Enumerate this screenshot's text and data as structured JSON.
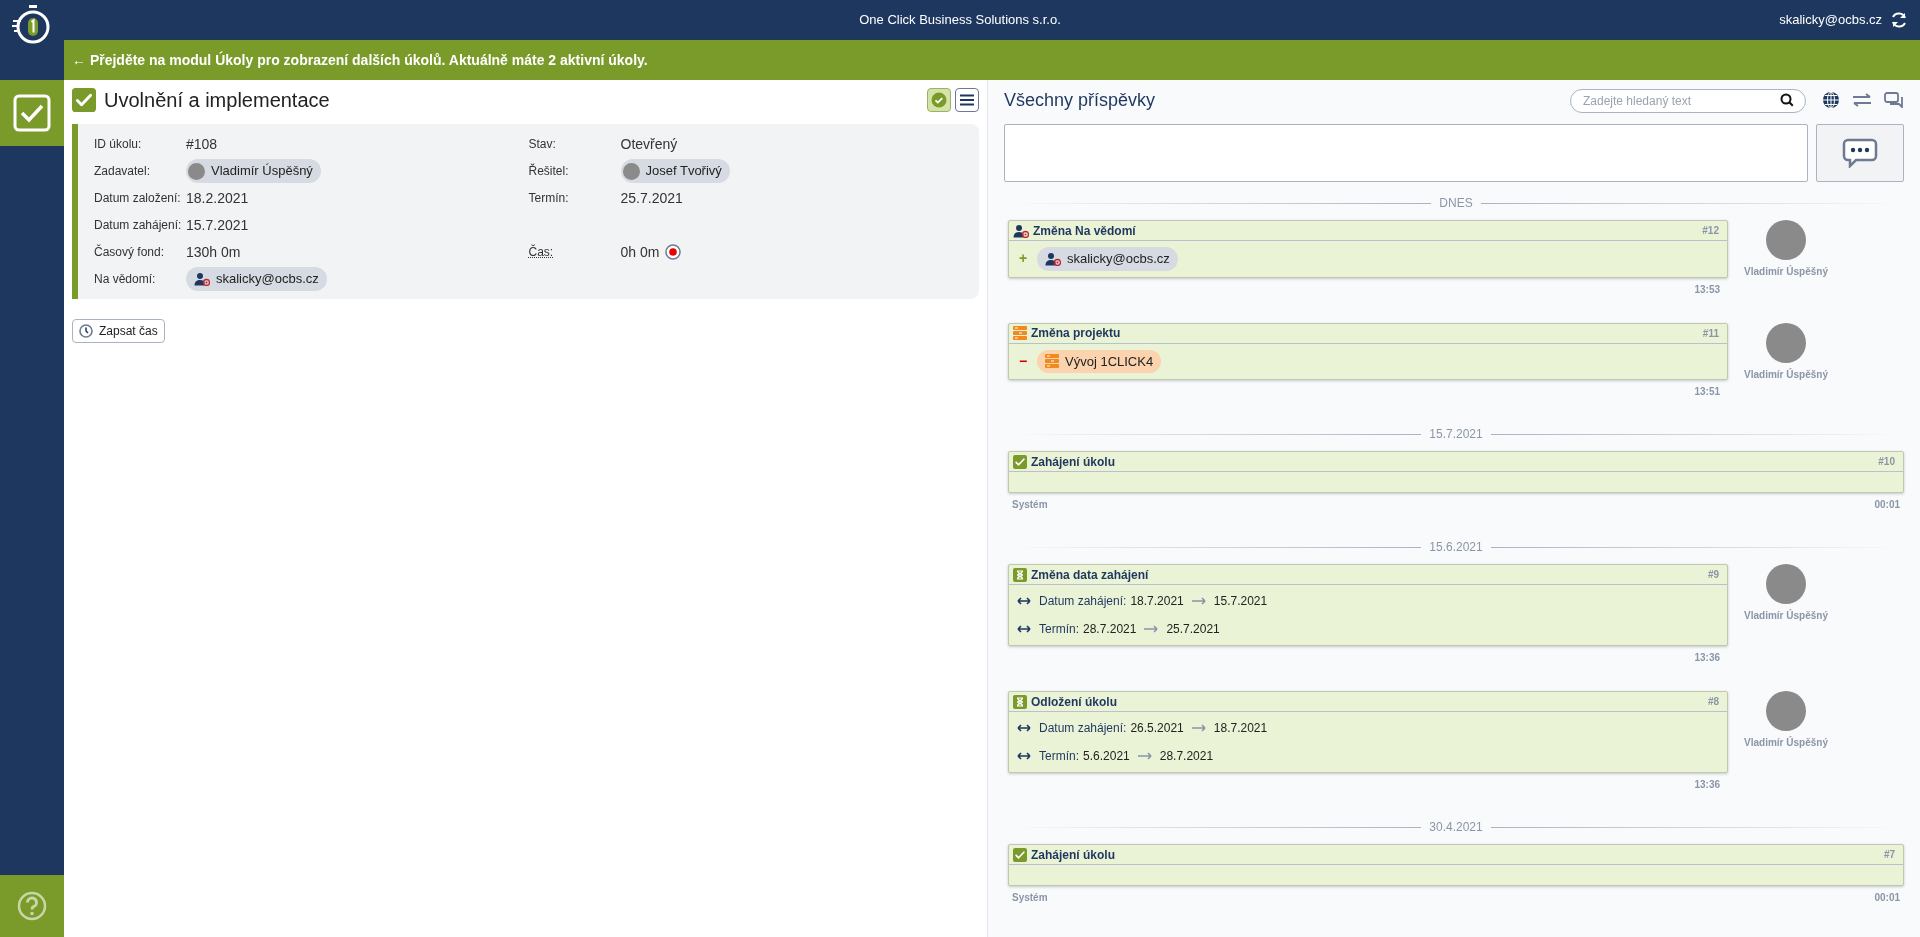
{
  "header": {
    "company": "One Click Business Solutions s.r.o.",
    "user": "skalicky@ocbs.cz"
  },
  "banner": "← Přejděte na modul Úkoly pro zobrazení dalších úkolů. Aktuálně máte 2 aktivní úkoly.",
  "sidebar": {
    "items": [
      {
        "kind": "tasks",
        "selected": true
      }
    ]
  },
  "task": {
    "title": "Uvolnění a implementace",
    "done": true,
    "rows": [
      {
        "left": {
          "label": "ID úkolu:",
          "kind": "text",
          "value": "#108"
        },
        "right": {
          "label": "Stav:",
          "kind": "text",
          "value": "Otevřený"
        }
      },
      {
        "left": {
          "label": "Zadavatel:",
          "kind": "person",
          "value": "Vladimír Úspěšný"
        },
        "right": {
          "label": "Řešitel:",
          "kind": "person",
          "value": "Josef Tvořivý"
        }
      },
      {
        "left": {
          "label": "Datum založení:",
          "kind": "text",
          "value": "18.2.2021"
        },
        "right": {
          "label": "Termín:",
          "kind": "text",
          "value": "25.7.2021"
        }
      },
      {
        "left": {
          "label": "Datum zahájení:",
          "kind": "text",
          "value": "15.7.2021"
        }
      },
      {
        "left": {
          "label": "Časový fond:",
          "kind": "text",
          "value": "130h 0m"
        },
        "right": {
          "label": "Čas:",
          "kind": "timer",
          "value": "0h 0m"
        }
      },
      {
        "left": {
          "label": "Na vědomí:",
          "kind": "observer",
          "value": "skalicky@ocbs.cz"
        }
      }
    ],
    "log_button": "Zapsat čas"
  },
  "posts": {
    "title": "Všechny příspěvky",
    "search": {
      "placeholder": "Zadejte hledaný text"
    },
    "feed": [
      {
        "kind": "divider",
        "label": "DNES"
      },
      {
        "kind": "observer_change",
        "title": "Změna Na vědomí",
        "number": "#12",
        "time": "13:53",
        "author": "Vladimír Úspěšný",
        "lines": [
          {
            "kind": "observer",
            "sign": "+",
            "chip": "skalicky@ocbs.cz"
          }
        ]
      },
      {
        "kind": "project_change",
        "title": "Změna projektu",
        "number": "#11",
        "time": "13:51",
        "author": "Vladimír Úspěšný",
        "lines": [
          {
            "kind": "project",
            "sign": "−",
            "chip": "Vývoj 1CLICK4"
          }
        ]
      },
      {
        "kind": "divider",
        "label": "15.7.2021"
      },
      {
        "kind": "start",
        "title": "Zahájení úkolu",
        "number": "#10",
        "time": "00:01",
        "author": "Systém"
      },
      {
        "kind": "divider",
        "label": "15.6.2021"
      },
      {
        "kind": "date_change",
        "title": "Změna data zahájení",
        "number": "#9",
        "time": "13:36",
        "author": "Vladimír Úspěšný",
        "lines": [
          {
            "kind": "change",
            "label": "Datum zahájení:",
            "from": "18.7.2021",
            "to": "15.7.2021"
          },
          {
            "kind": "change",
            "label": "Termín:",
            "from": "28.7.2021",
            "to": "25.7.2021"
          }
        ]
      },
      {
        "kind": "date_change",
        "title": "Odložení úkolu",
        "number": "#8",
        "time": "13:36",
        "author": "Vladimír Úspěšný",
        "lines": [
          {
            "kind": "change",
            "label": "Datum zahájení:",
            "from": "26.5.2021",
            "to": "18.7.2021"
          },
          {
            "kind": "change",
            "label": "Termín:",
            "from": "5.6.2021",
            "to": "28.7.2021"
          }
        ]
      },
      {
        "kind": "divider",
        "label": "30.4.2021"
      },
      {
        "kind": "start",
        "title": "Zahájení úkolu",
        "number": "#7",
        "time": "00:01",
        "author": "Systém"
      }
    ]
  }
}
